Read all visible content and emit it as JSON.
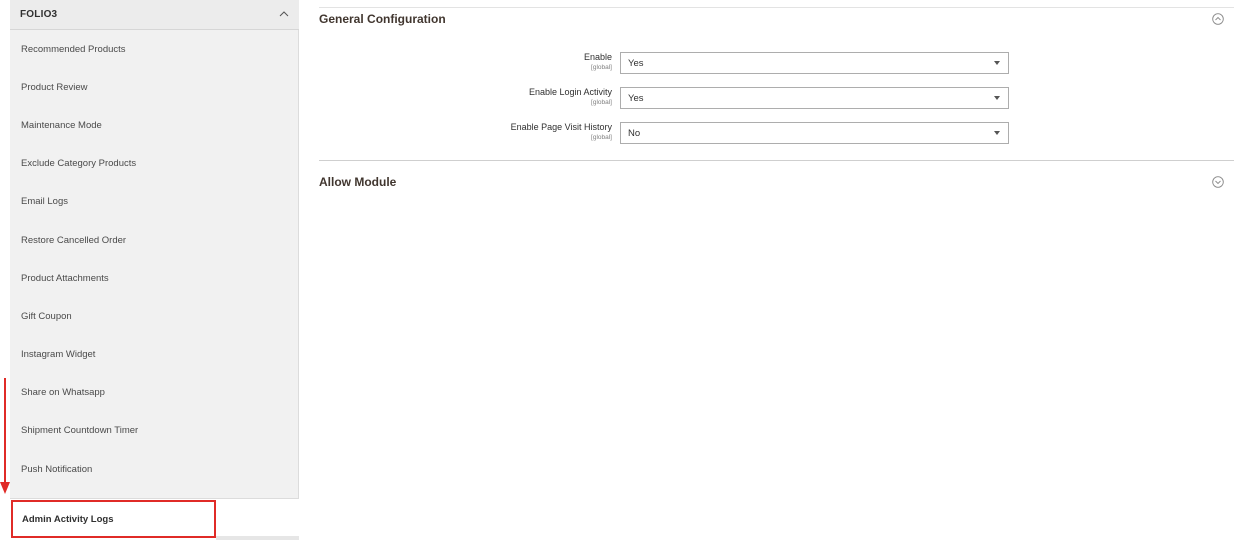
{
  "sidebar": {
    "title": "FOLIO3",
    "items": [
      {
        "label": "Recommended Products"
      },
      {
        "label": "Product Review"
      },
      {
        "label": "Maintenance Mode"
      },
      {
        "label": "Exclude Category Products"
      },
      {
        "label": "Email Logs"
      },
      {
        "label": "Restore Cancelled Order"
      },
      {
        "label": "Product Attachments"
      },
      {
        "label": "Gift Coupon"
      },
      {
        "label": "Instagram Widget"
      },
      {
        "label": "Share on Whatsapp"
      },
      {
        "label": "Shipment Countdown Timer"
      },
      {
        "label": "Push Notification"
      }
    ],
    "active_item": "Admin Activity Logs"
  },
  "general": {
    "title": "General Configuration",
    "fields": [
      {
        "label": "Enable",
        "scope": "[global]",
        "value": "Yes"
      },
      {
        "label": "Enable Login Activity",
        "scope": "[global]",
        "value": "Yes"
      },
      {
        "label": "Enable Page Visit History",
        "scope": "[global]",
        "value": "No"
      }
    ]
  },
  "allow_module": {
    "title": "Allow Module"
  },
  "colors": {
    "highlight": "#e02b27",
    "sidebar_bg": "#f1f1f1"
  }
}
